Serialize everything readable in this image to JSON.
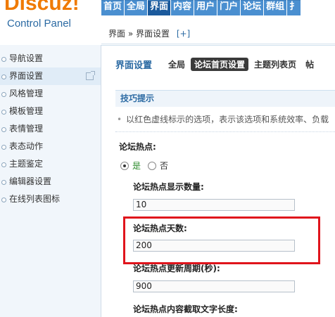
{
  "brand": {
    "logo": "Discuz!",
    "subtitle": "Control Panel"
  },
  "topnav": [
    "首页",
    "全局",
    "界面",
    "内容",
    "用户",
    "门户",
    "论坛",
    "群组",
    "扌"
  ],
  "topnav_active": 2,
  "breadcrumb": {
    "text": "界面 » 界面设置",
    "plus": "[+]"
  },
  "sidebar": {
    "items": [
      "导航设置",
      "界面设置",
      "风格管理",
      "模板管理",
      "表情管理",
      "表态动作",
      "主题鉴定",
      "编辑器设置",
      "在线列表图标"
    ],
    "active": 1
  },
  "page": {
    "title": "界面设置",
    "tabs": [
      "全局",
      "论坛首页设置",
      "主题列表页",
      "帖"
    ],
    "active_tab": 1
  },
  "tips": {
    "heading": "技巧提示",
    "text": "以红色虚线标示的选项，表示该选项和系统效率、负载"
  },
  "settings": {
    "hot_label": "论坛热点:",
    "yes": "是",
    "no": "否",
    "count_label": "论坛热点显示数量:",
    "count_value": "10",
    "days_label": "论坛热点天数:",
    "days_value": "200",
    "period_label": "论坛热点更新周期(秒):",
    "period_value": "900",
    "length_label": "论坛热点内容截取文字长度:"
  },
  "colors": {
    "accent": "#2b6aa3",
    "nav": "#4a8fd0",
    "nav_active": "#1b5a9c",
    "highlight": "#e0141c",
    "logo": "#ef7a00"
  }
}
